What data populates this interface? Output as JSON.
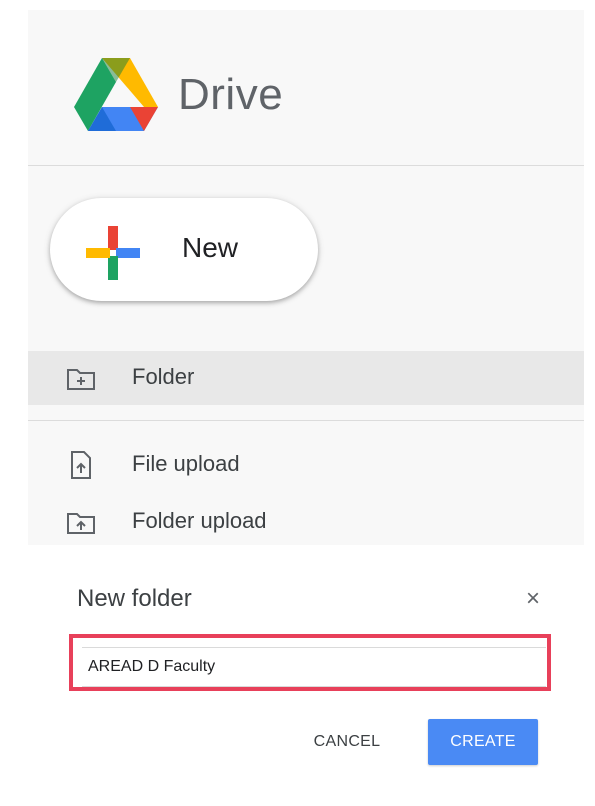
{
  "app": {
    "title": "Drive"
  },
  "new_button": {
    "label": "New"
  },
  "menu": {
    "items": [
      {
        "label": "Folder",
        "icon": "folder-plus-icon"
      },
      {
        "label": "File upload",
        "icon": "file-upload-icon"
      },
      {
        "label": "Folder upload",
        "icon": "folder-upload-icon"
      }
    ]
  },
  "dialog": {
    "title": "New folder",
    "close_glyph": "×",
    "input_value": "AREAD D Faculty",
    "cancel_label": "CANCEL",
    "create_label": "CREATE"
  },
  "colors": {
    "accent": "#4a8af4",
    "highlight_border": "#e8405a",
    "drive_green": "#1ea362",
    "drive_yellow": "#ffba00",
    "drive_blue": "#4285f4",
    "drive_red": "#ea4335"
  }
}
